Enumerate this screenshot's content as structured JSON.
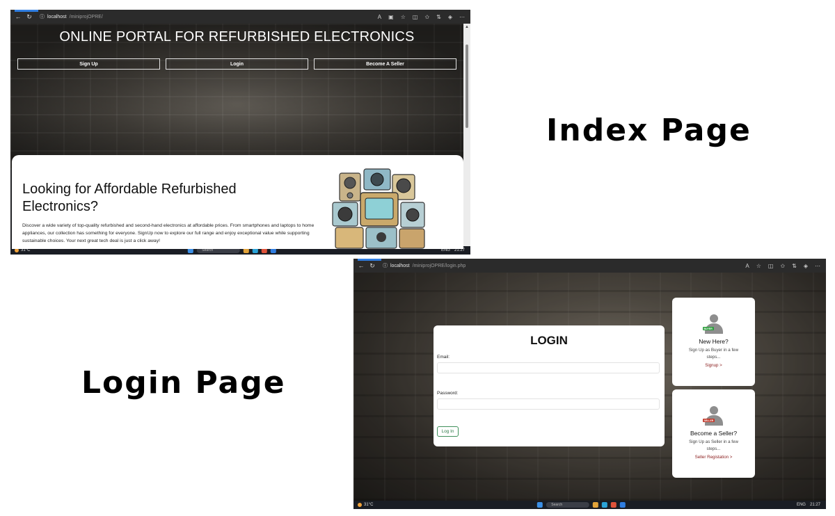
{
  "index_screenshot": {
    "browser": {
      "url_host": "localhost",
      "url_path": "/miniprojOPRE/",
      "nav_icons": [
        "back-icon",
        "refresh-icon"
      ],
      "tool_icons": [
        "read-aloud-icon",
        "app-icon",
        "favorite-star-icon",
        "split-view-icon",
        "favorites-icon",
        "extensions-icon",
        "copilot-icon",
        "more-icon"
      ]
    },
    "hero": {
      "title": "ONLINE PORTAL FOR REFURBISHED ELECTRONICS",
      "buttons": [
        "Sign Up",
        "Login",
        "Become A Seller"
      ]
    },
    "content": {
      "heading": "Looking for Affordable Refurbished Electronics?",
      "paragraph": "Discover a wide variety of top-quality refurbished and second-hand electronics at affordable prices. From smartphones and laptops to home appliances, our collection has something for everyone. SignUp now to explore our full range and enjoy exceptional value while supporting sustainable choices. Your next great tech deal is just a click away!"
    },
    "taskbar": {
      "weather": "31°C",
      "search": "Search",
      "lang": "ENG",
      "time": "21:27"
    }
  },
  "labels": {
    "index": "Index Page",
    "login": "Login Page"
  },
  "login_screenshot": {
    "browser": {
      "url_host": "localhost",
      "url_path": "/miniprojOPRE/login.php"
    },
    "login_form": {
      "title": "LOGIN",
      "email_label": "Email:",
      "email_value": "",
      "password_label": "Password:",
      "password_value": "",
      "submit_label": "Log In"
    },
    "buyer_card": {
      "badge": "BUYER",
      "title": "New Here?",
      "description": "Sign Up as Buyer in a few steps...",
      "link": "Signup >"
    },
    "seller_card": {
      "badge": "SELLER",
      "title": "Become a Seller?",
      "description": "Sign Up as Seller in a few steps...",
      "link": "Seller Registation >"
    },
    "taskbar": {
      "weather": "31°C",
      "search": "Search",
      "lang": "ENG",
      "time": "21:27"
    }
  },
  "colors": {
    "accent_link": "#8a1c1c",
    "login_button": "#2f7a49",
    "buyer_badge": "#2e9e3e",
    "seller_badge": "#c0392b"
  }
}
